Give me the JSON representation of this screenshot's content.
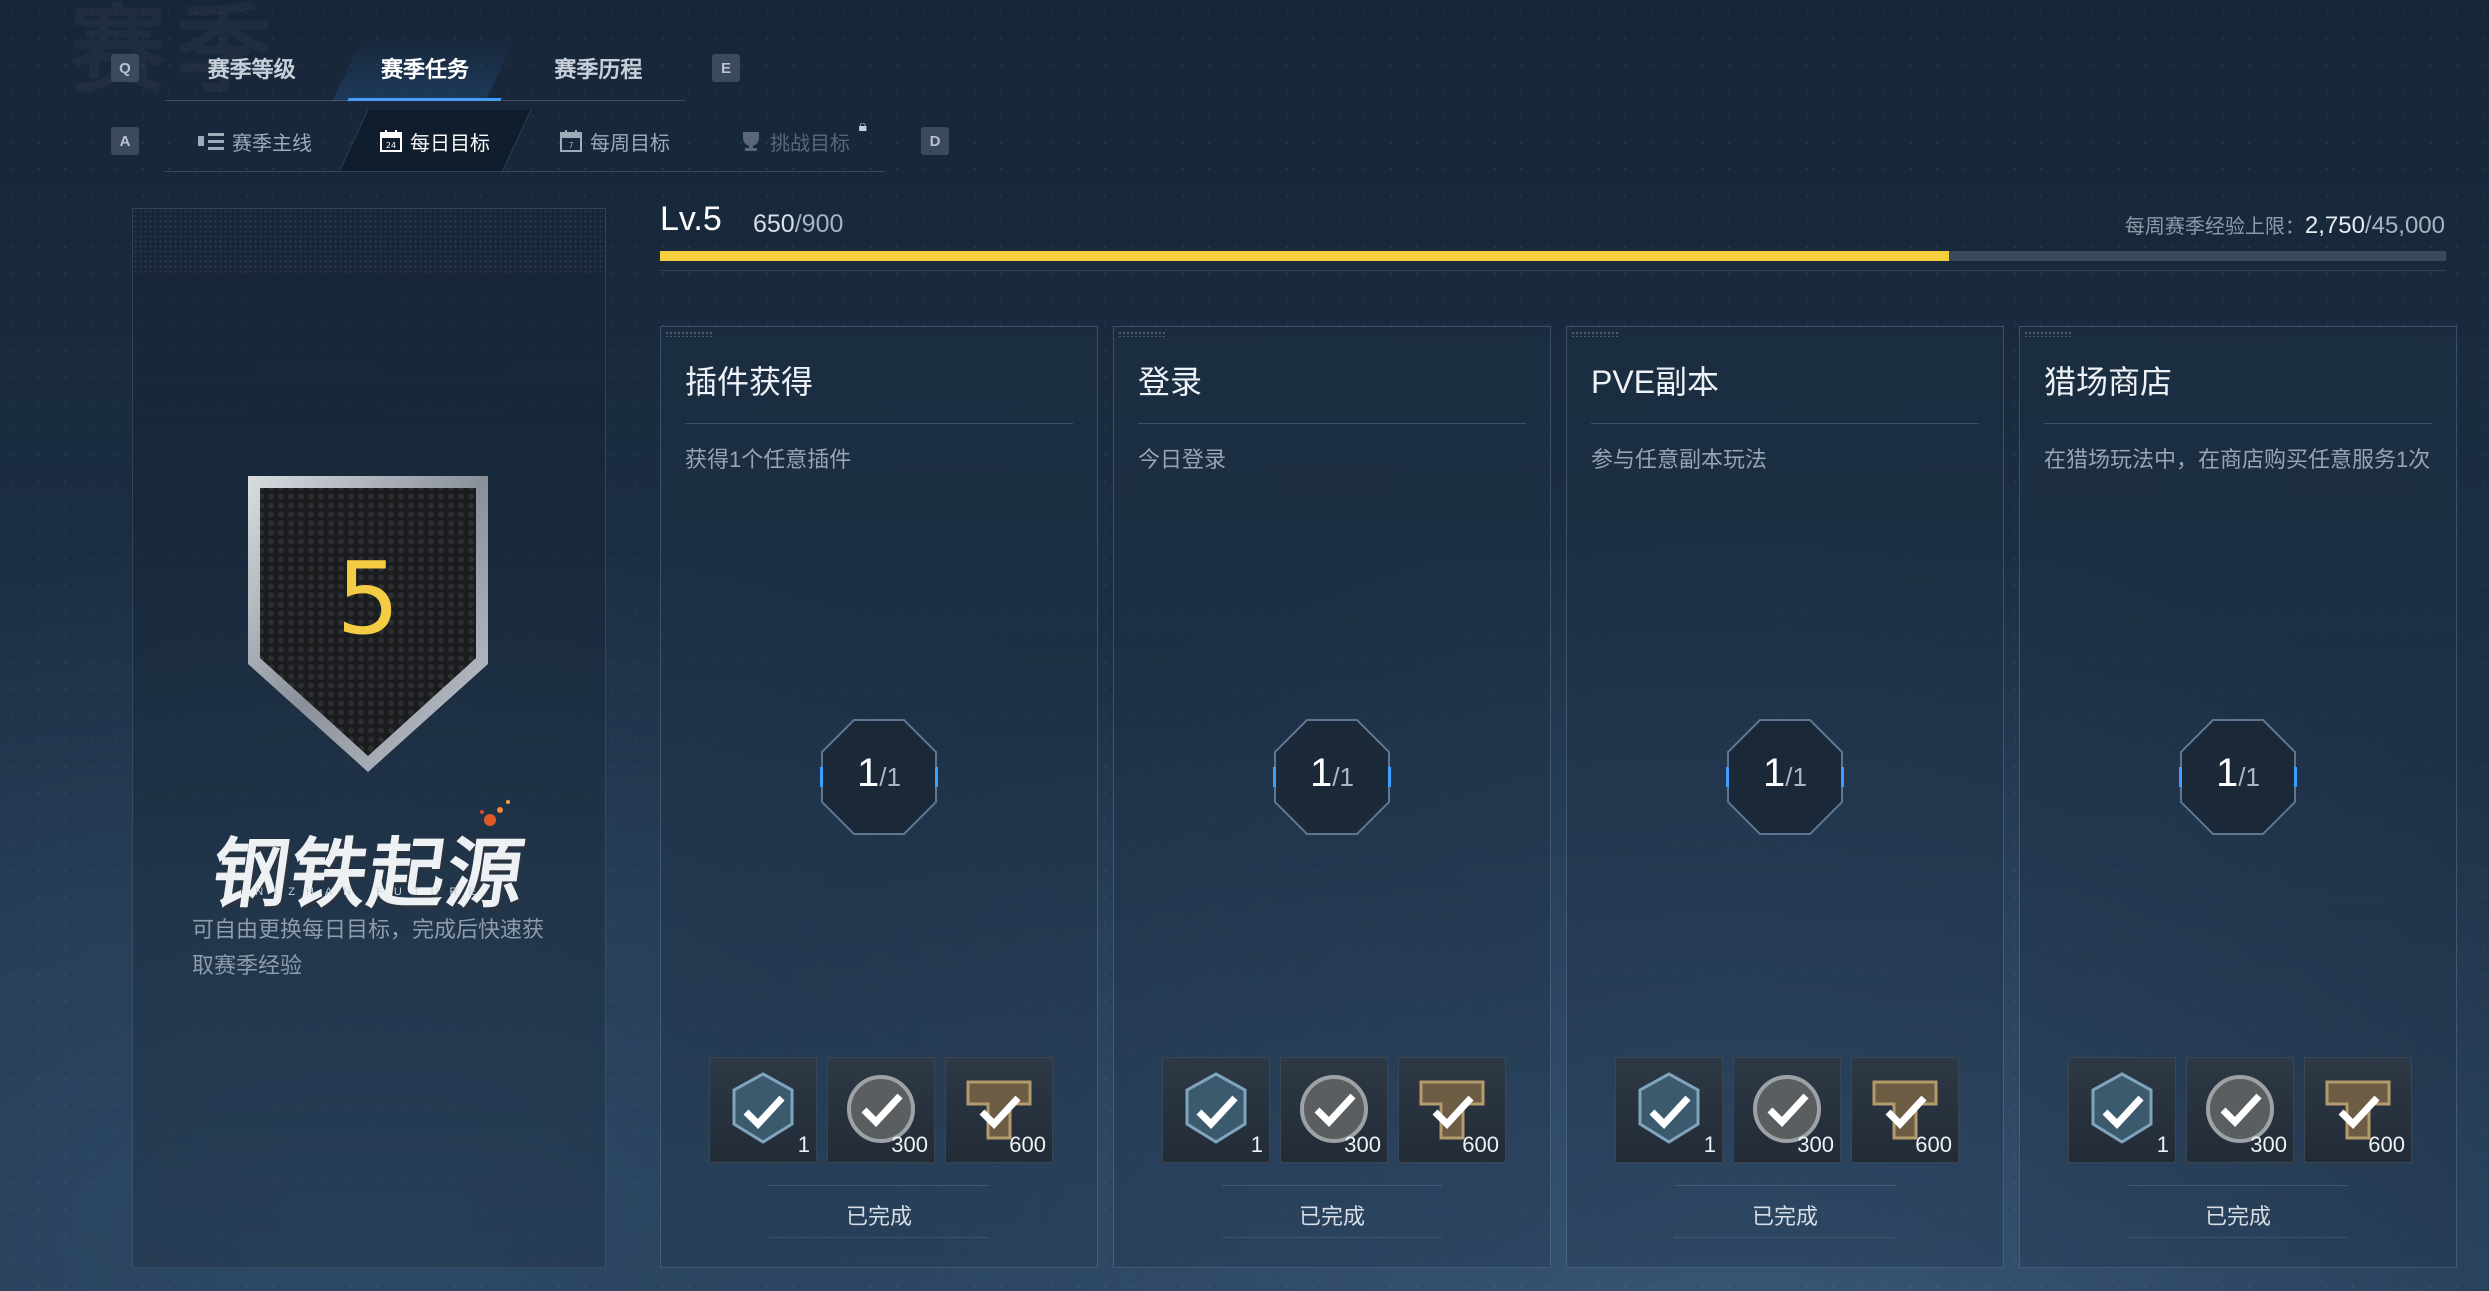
{
  "keys": {
    "prev_tab": "Q",
    "next_tab": "E",
    "prev_sub": "A",
    "next_sub": "D"
  },
  "tabs": [
    {
      "label": "赛季等级",
      "active": false
    },
    {
      "label": "赛季任务",
      "active": true
    },
    {
      "label": "赛季历程",
      "active": false
    }
  ],
  "subtabs": [
    {
      "label": "赛季主线",
      "icon": "list-icon",
      "active": false
    },
    {
      "label": "每日目标",
      "icon": "calendar-icon",
      "active": true
    },
    {
      "label": "每周目标",
      "icon": "calendar-week-icon",
      "active": false
    },
    {
      "label": "挑战目标",
      "icon": "trophy-icon",
      "active": false,
      "locked": true
    }
  ],
  "left": {
    "level": "5",
    "logo_text": "钢铁起源",
    "logo_sub": "NIZHAN FUTURE",
    "description": "可自由更换每日目标，完成后快速获取赛季经验"
  },
  "level_bar": {
    "label": "Lv.5",
    "current": "650",
    "max": "/900",
    "progress": 0.722,
    "weekly_label": "每周赛季经验上限：",
    "weekly_current": "2,750",
    "weekly_max": "/45,000",
    "fill_color": "#f5cf3e"
  },
  "cards": [
    {
      "title": "插件获得",
      "desc": "获得1个任意插件",
      "progress": "1",
      "total": "/1",
      "rewards": [
        {
          "icon": "plugin-icon",
          "count": "1"
        },
        {
          "icon": "coin-icon",
          "count": "300"
        },
        {
          "icon": "season-exp-icon",
          "count": "600"
        }
      ],
      "status": "已完成"
    },
    {
      "title": "登录",
      "desc": "今日登录",
      "progress": "1",
      "total": "/1",
      "rewards": [
        {
          "icon": "plugin-icon",
          "count": "1"
        },
        {
          "icon": "coin-icon",
          "count": "300"
        },
        {
          "icon": "season-exp-icon",
          "count": "600"
        }
      ],
      "status": "已完成"
    },
    {
      "title": "PVE副本",
      "desc": "参与任意副本玩法",
      "progress": "1",
      "total": "/1",
      "rewards": [
        {
          "icon": "plugin-icon",
          "count": "1"
        },
        {
          "icon": "coin-icon",
          "count": "300"
        },
        {
          "icon": "season-exp-icon",
          "count": "600"
        }
      ],
      "status": "已完成"
    },
    {
      "title": "猎场商店",
      "desc": "在猎场玩法中，在商店购买任意服务1次",
      "progress": "1",
      "total": "/1",
      "rewards": [
        {
          "icon": "plugin-icon",
          "count": "1"
        },
        {
          "icon": "coin-icon",
          "count": "300"
        },
        {
          "icon": "season-exp-icon",
          "count": "600"
        }
      ],
      "status": "已完成"
    }
  ]
}
